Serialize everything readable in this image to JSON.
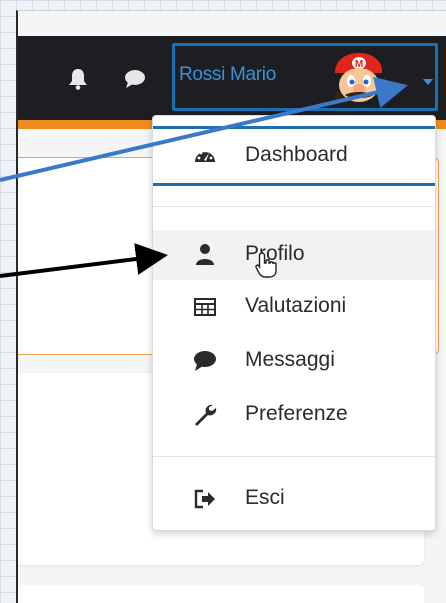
{
  "header": {
    "user_name": "Rossi Mario",
    "icons": {
      "notifications": "bell-icon",
      "messages": "chat-bubble-icon",
      "expand": "caret-down-icon"
    }
  },
  "user_menu": {
    "items": [
      {
        "label": "Dashboard",
        "icon": "tachometer-icon"
      },
      {
        "label": "Profilo",
        "icon": "user-icon"
      },
      {
        "label": "Valutazioni",
        "icon": "table-icon"
      },
      {
        "label": "Messaggi",
        "icon": "comment-icon"
      },
      {
        "label": "Preferenze",
        "icon": "wrench-icon"
      },
      {
        "label": "Esci",
        "icon": "sign-out-icon"
      }
    ]
  },
  "colors": {
    "topbar": "#1d1e22",
    "accent_orange": "#f08c1e",
    "highlight_blue": "#1b6fb3",
    "annotation_arrow_blue": "#3c78c8",
    "annotation_arrow_black": "#000000"
  }
}
